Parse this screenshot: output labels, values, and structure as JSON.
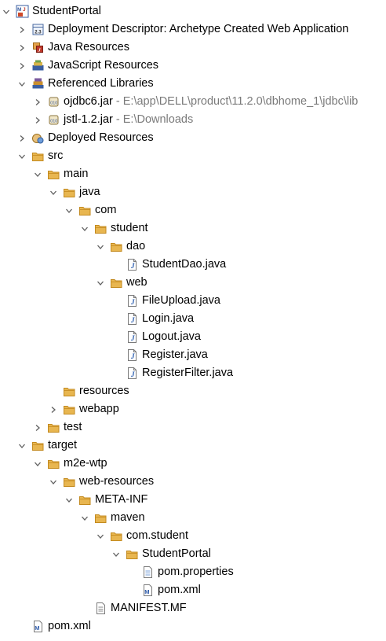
{
  "tree": [
    {
      "label": "StudentPortal",
      "icon": "maven-project-icon",
      "depth": 0,
      "expanded": true
    },
    {
      "label": "Deployment Descriptor: Archetype Created Web Application",
      "icon": "deployment-descriptor-icon",
      "depth": 1,
      "expanded": false
    },
    {
      "label": "Java Resources",
      "icon": "java-resources-icon",
      "depth": 1,
      "expanded": false
    },
    {
      "label": "JavaScript Resources",
      "icon": "javascript-resources-icon",
      "depth": 1,
      "expanded": false
    },
    {
      "label": "Referenced Libraries",
      "icon": "referenced-libraries-icon",
      "depth": 1,
      "expanded": true
    },
    {
      "label": "ojdbc6.jar",
      "suffix": " - E:\\app\\DELL\\product\\11.2.0\\dbhome_1\\jdbc\\lib",
      "icon": "jar-icon",
      "depth": 2,
      "expanded": false
    },
    {
      "label": "jstl-1.2.jar",
      "suffix": " - E:\\Downloads",
      "icon": "jar-icon",
      "depth": 2,
      "expanded": false
    },
    {
      "label": "Deployed Resources",
      "icon": "deployed-resources-icon",
      "depth": 1,
      "expanded": false
    },
    {
      "label": "src",
      "icon": "folder-icon",
      "depth": 1,
      "expanded": true
    },
    {
      "label": "main",
      "icon": "folder-icon",
      "depth": 2,
      "expanded": true
    },
    {
      "label": "java",
      "icon": "folder-icon",
      "depth": 3,
      "expanded": true
    },
    {
      "label": "com",
      "icon": "folder-icon",
      "depth": 4,
      "expanded": true
    },
    {
      "label": "student",
      "icon": "folder-icon",
      "depth": 5,
      "expanded": true
    },
    {
      "label": "dao",
      "icon": "folder-icon",
      "depth": 6,
      "expanded": true
    },
    {
      "label": "StudentDao.java",
      "icon": "java-file-icon",
      "depth": 7
    },
    {
      "label": "web",
      "icon": "folder-icon",
      "depth": 6,
      "expanded": true
    },
    {
      "label": "FileUpload.java",
      "icon": "java-file-icon",
      "depth": 7
    },
    {
      "label": "Login.java",
      "icon": "java-file-icon",
      "depth": 7
    },
    {
      "label": "Logout.java",
      "icon": "java-file-icon",
      "depth": 7
    },
    {
      "label": "Register.java",
      "icon": "java-file-icon",
      "depth": 7
    },
    {
      "label": "RegisterFilter.java",
      "icon": "java-file-icon",
      "depth": 7
    },
    {
      "label": "resources",
      "icon": "folder-icon",
      "depth": 3
    },
    {
      "label": "webapp",
      "icon": "folder-icon",
      "depth": 3,
      "expanded": false
    },
    {
      "label": "test",
      "icon": "folder-icon",
      "depth": 2,
      "expanded": false
    },
    {
      "label": "target",
      "icon": "folder-icon",
      "depth": 1,
      "expanded": true
    },
    {
      "label": "m2e-wtp",
      "icon": "folder-icon",
      "depth": 2,
      "expanded": true
    },
    {
      "label": "web-resources",
      "icon": "folder-icon",
      "depth": 3,
      "expanded": true
    },
    {
      "label": "META-INF",
      "icon": "folder-icon",
      "depth": 4,
      "expanded": true
    },
    {
      "label": "maven",
      "icon": "folder-icon",
      "depth": 5,
      "expanded": true
    },
    {
      "label": "com.student",
      "icon": "folder-icon",
      "depth": 6,
      "expanded": true
    },
    {
      "label": "StudentPortal",
      "icon": "folder-icon",
      "depth": 7,
      "expanded": true
    },
    {
      "label": "pom.properties",
      "icon": "properties-file-icon",
      "depth": 8
    },
    {
      "label": "pom.xml",
      "icon": "maven-pom-icon",
      "depth": 8
    },
    {
      "label": "MANIFEST.MF",
      "icon": "manifest-file-icon",
      "depth": 5
    },
    {
      "label": "pom.xml",
      "icon": "maven-pom-icon",
      "depth": 1
    }
  ],
  "colors": {
    "folder": "#e8b650",
    "folder_dark": "#c38a1f",
    "java_blue": "#2a5db0",
    "dim_text": "#7a7a7a"
  }
}
